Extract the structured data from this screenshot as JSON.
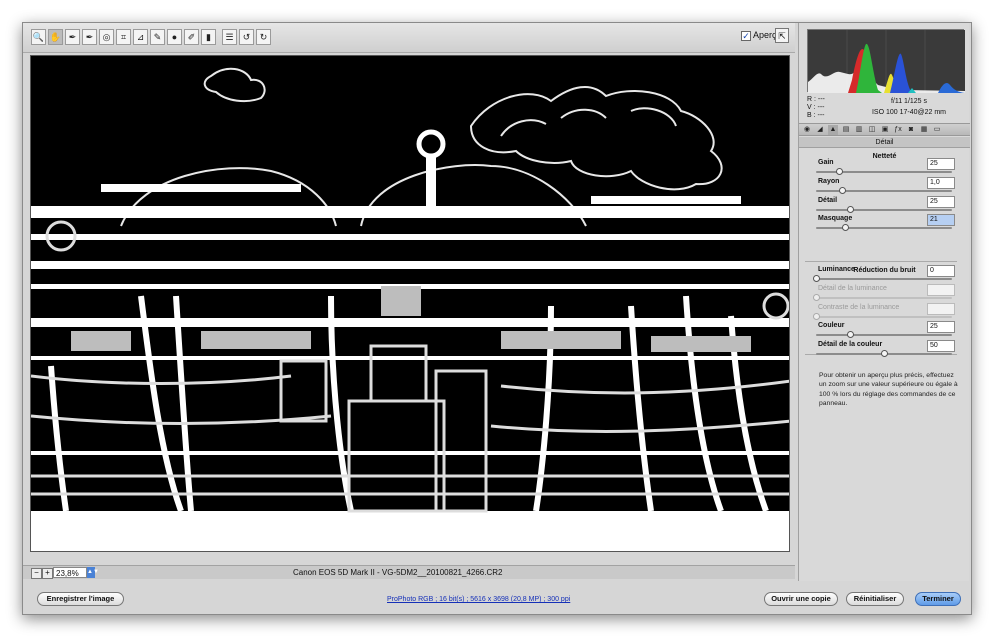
{
  "toolbar": {
    "tools": [
      {
        "icon": "zoom-tool-icon",
        "glyph": "🔍"
      },
      {
        "icon": "hand-tool-icon",
        "glyph": "✋"
      },
      {
        "icon": "white-balance-tool-icon",
        "glyph": "✒"
      },
      {
        "icon": "color-sampler-tool-icon",
        "glyph": "✒"
      },
      {
        "icon": "targeted-adjustment-tool-icon",
        "glyph": "◎"
      },
      {
        "icon": "crop-tool-icon",
        "glyph": "⌗"
      },
      {
        "icon": "straighten-tool-icon",
        "glyph": "⊿"
      },
      {
        "icon": "spot-removal-tool-icon",
        "glyph": "✎"
      },
      {
        "icon": "red-eye-tool-icon",
        "glyph": "●"
      },
      {
        "icon": "adjustment-brush-icon",
        "glyph": "✐"
      },
      {
        "icon": "graduated-filter-icon",
        "glyph": "▮"
      },
      {
        "icon": "preferences-icon",
        "glyph": "☰"
      },
      {
        "icon": "rotate-left-icon",
        "glyph": "↺"
      },
      {
        "icon": "rotate-right-icon",
        "glyph": "↻"
      }
    ],
    "preview_checked": "✓",
    "preview_label": "Aperçu",
    "fullscreen_glyph": "⇱"
  },
  "status": {
    "zoom_out": "−",
    "zoom_in": "+",
    "zoom": "23,8%",
    "file_name": "Canon EOS 5D Mark II  -  VG-5DM2__20100821_4266.CR2"
  },
  "histogram": {
    "r": "R :  ---",
    "g": "V :  ---",
    "b": "B :  ---",
    "exposure": "f/11    1/125 s",
    "iso_lens": "ISO 100    17-40@22 mm"
  },
  "panel": {
    "title": "Détail",
    "sharpening_title": "Netteté",
    "noise_title": "Réduction du bruit",
    "info": "Pour obtenir un aperçu plus précis, effectuez un zoom sur une valeur supérieure ou égale à 100 % lors du réglage des commandes de ce panneau.",
    "sliders": [
      {
        "label": "Gain",
        "value": "25",
        "level": 0.17,
        "disabled": false
      },
      {
        "label": "Rayon",
        "value": "1,0",
        "level": 0.19,
        "disabled": false
      },
      {
        "label": "Détail",
        "value": "25",
        "level": 0.25,
        "disabled": false
      },
      {
        "label": "Masquage",
        "value": "21",
        "level": 0.21,
        "disabled": false,
        "selected": true
      },
      {
        "label": "Luminance",
        "value": "0",
        "level": 0.0,
        "disabled": false
      },
      {
        "label": "Détail de la luminance",
        "value": "",
        "level": 0.0,
        "disabled": true
      },
      {
        "label": "Contraste de la luminance",
        "value": "",
        "level": 0.0,
        "disabled": true
      },
      {
        "label": "Couleur",
        "value": "25",
        "level": 0.25,
        "disabled": false
      },
      {
        "label": "Détail de la couleur",
        "value": "50",
        "level": 0.5,
        "disabled": false
      }
    ]
  },
  "footer": {
    "save": "Enregistrer l'image",
    "workflow": "ProPhoto RGB ; 16 bit(s) ; 5616 x 3698 (20,8 MP) ; 300 ppi",
    "open_copy": "Ouvrir une copie",
    "reset": "Réinitialiser",
    "done": "Terminer"
  }
}
